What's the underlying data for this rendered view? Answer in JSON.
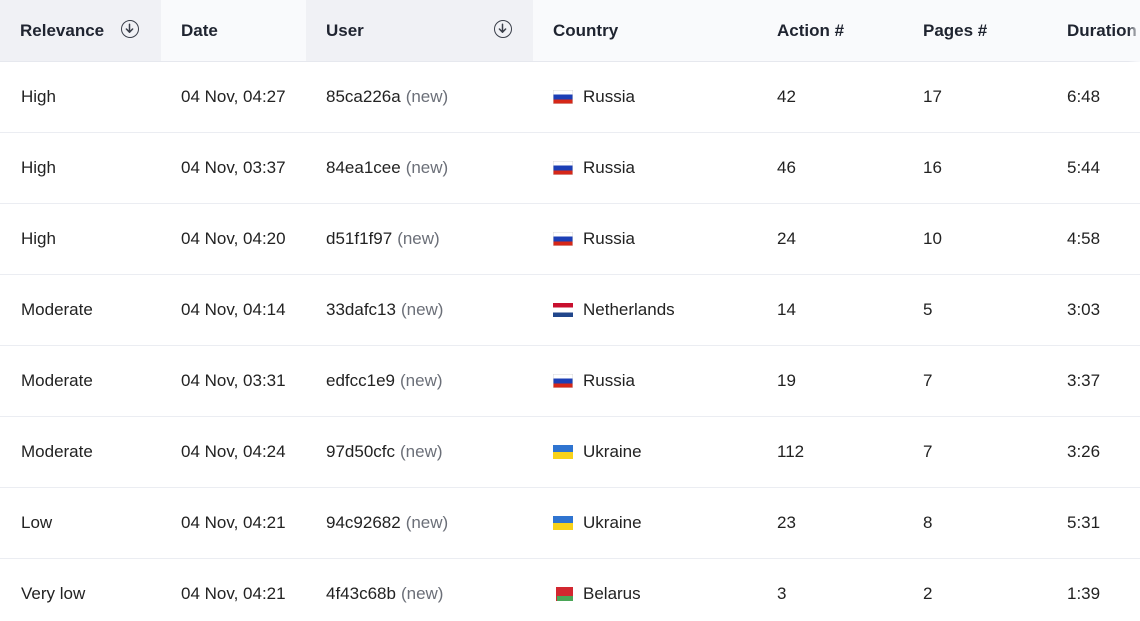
{
  "columns": [
    {
      "key": "relevance",
      "label": "Relevance",
      "sortable": true
    },
    {
      "key": "date",
      "label": "Date",
      "sortable": false
    },
    {
      "key": "user",
      "label": "User",
      "sortable": true
    },
    {
      "key": "country",
      "label": "Country",
      "sortable": false
    },
    {
      "key": "actions",
      "label": "Action #",
      "sortable": false
    },
    {
      "key": "pages",
      "label": "Pages #",
      "sortable": false
    },
    {
      "key": "duration",
      "label": "Duration",
      "sortable": false
    }
  ],
  "new_suffix": "(new)",
  "flags": {
    "Russia": [
      "#ffffff",
      "#1c3fb6",
      "#d62718"
    ],
    "Netherlands": [
      "#c8102e",
      "#ffffff",
      "#21468b"
    ],
    "Ukraine": [
      "#2f74d0",
      "#f8d21a"
    ],
    "Belarus": [
      "#d22730",
      "#d22730",
      "#4aa657"
    ]
  },
  "rows": [
    {
      "relevance": "High",
      "date": "04 Nov, 04:27",
      "user": "85ca226a",
      "country": "Russia",
      "actions": "42",
      "pages": "17",
      "duration": "6:48"
    },
    {
      "relevance": "High",
      "date": "04 Nov, 03:37",
      "user": "84ea1cee",
      "country": "Russia",
      "actions": "46",
      "pages": "16",
      "duration": "5:44"
    },
    {
      "relevance": "High",
      "date": "04 Nov, 04:20",
      "user": "d51f1f97",
      "country": "Russia",
      "actions": "24",
      "pages": "10",
      "duration": "4:58"
    },
    {
      "relevance": "Moderate",
      "date": "04 Nov, 04:14",
      "user": "33dafc13",
      "country": "Netherlands",
      "actions": "14",
      "pages": "5",
      "duration": "3:03"
    },
    {
      "relevance": "Moderate",
      "date": "04 Nov, 03:31",
      "user": "edfcc1e9",
      "country": "Russia",
      "actions": "19",
      "pages": "7",
      "duration": "3:37"
    },
    {
      "relevance": "Moderate",
      "date": "04 Nov, 04:24",
      "user": "97d50cfc",
      "country": "Ukraine",
      "actions": "112",
      "pages": "7",
      "duration": "3:26"
    },
    {
      "relevance": "Low",
      "date": "04 Nov, 04:21",
      "user": "94c92682",
      "country": "Ukraine",
      "actions": "23",
      "pages": "8",
      "duration": "5:31"
    },
    {
      "relevance": "Very low",
      "date": "04 Nov, 04:21",
      "user": "4f43c68b",
      "country": "Belarus",
      "actions": "3",
      "pages": "2",
      "duration": "1:39"
    }
  ]
}
